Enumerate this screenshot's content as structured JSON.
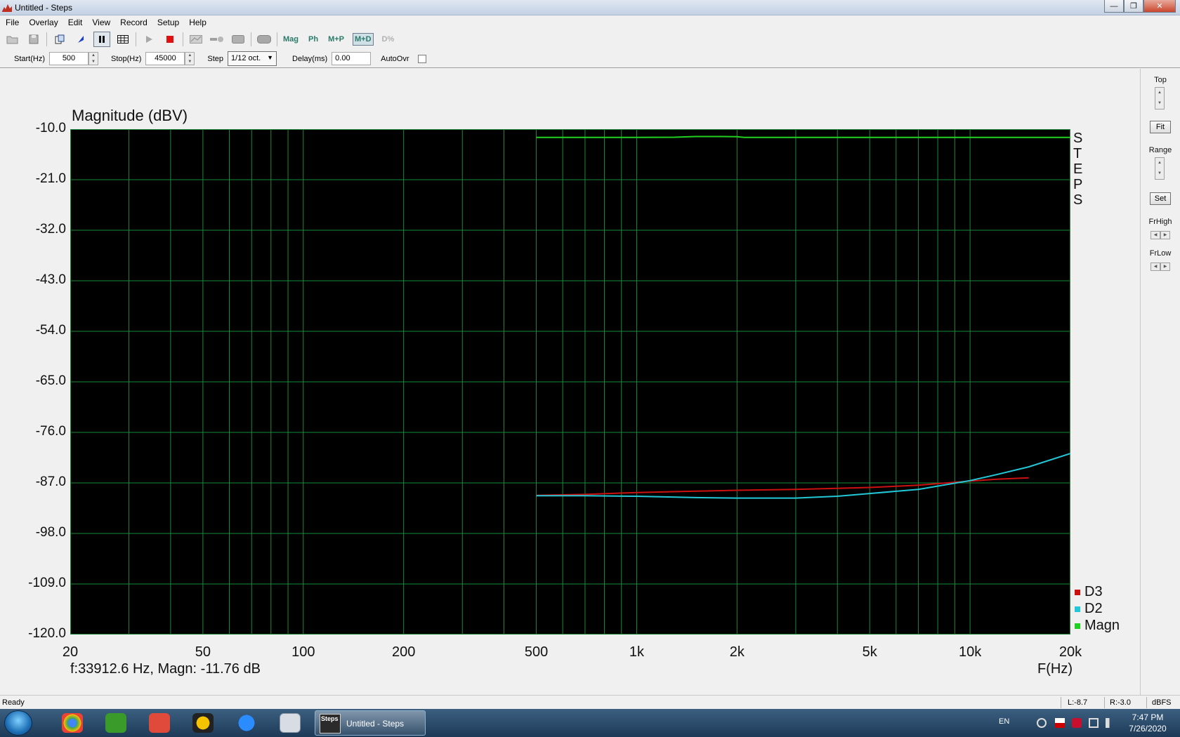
{
  "window": {
    "title": "Untitled - Steps",
    "min_glyph": "—",
    "max_glyph": "❐",
    "close_glyph": "✕"
  },
  "menu": [
    "File",
    "Overlay",
    "Edit",
    "View",
    "Record",
    "Setup",
    "Help"
  ],
  "toolbar": {
    "text_buttons": [
      {
        "label": "Mag",
        "state": "normal"
      },
      {
        "label": "Ph",
        "state": "normal"
      },
      {
        "label": "M+P",
        "state": "normal"
      },
      {
        "label": "M+D",
        "state": "pressed"
      },
      {
        "label": "D%",
        "state": "disabled"
      }
    ]
  },
  "params": {
    "start_label": "Start(Hz)",
    "start_value": "500",
    "stop_label": "Stop(Hz)",
    "stop_value": "45000",
    "step_label": "Step",
    "step_value": "1/12 oct.",
    "delay_label": "Delay(ms)",
    "delay_value": "0.00",
    "autoovr_label": "AutoOvr",
    "autoovr_checked": false
  },
  "chart_data": {
    "type": "line",
    "title": "Magnitude (dBV)",
    "xlabel": "F(Hz)",
    "x_scale": "log",
    "xlim": [
      20,
      20000
    ],
    "ylim": [
      -120,
      -10
    ],
    "grid": true,
    "background": "#000000",
    "grid_color": "#1a8a3a",
    "yticks": [
      "-10.0",
      "-21.0",
      "-32.0",
      "-43.0",
      "-54.0",
      "-65.0",
      "-76.0",
      "-87.0",
      "-98.0",
      "-109.0",
      "-120.0"
    ],
    "xticks": [
      {
        "v": 20,
        "label": "20"
      },
      {
        "v": 50,
        "label": "50"
      },
      {
        "v": 100,
        "label": "100"
      },
      {
        "v": 200,
        "label": "200"
      },
      {
        "v": 500,
        "label": "500"
      },
      {
        "v": 1000,
        "label": "1k"
      },
      {
        "v": 2000,
        "label": "2k"
      },
      {
        "v": 5000,
        "label": "5k"
      },
      {
        "v": 10000,
        "label": "10k"
      },
      {
        "v": 20000,
        "label": "20k"
      }
    ],
    "side_label": [
      "S",
      "T",
      "E",
      "P",
      "S"
    ],
    "legend_position": "bottom-right",
    "series": [
      {
        "name": "D3",
        "color": "#cc1111",
        "x": [
          500,
          700,
          1000,
          1500,
          2000,
          3000,
          5000,
          7000,
          10000,
          12000,
          15000
        ],
        "y": [
          -89.7,
          -89.5,
          -89.1,
          -88.8,
          -88.6,
          -88.4,
          -88.0,
          -87.5,
          -86.6,
          -86.2,
          -85.9
        ]
      },
      {
        "name": "D2",
        "color": "#22c8d8",
        "x": [
          500,
          700,
          1000,
          1500,
          2000,
          3000,
          4000,
          5000,
          7000,
          10000,
          12000,
          15000,
          20000
        ],
        "y": [
          -89.8,
          -89.8,
          -89.9,
          -90.2,
          -90.3,
          -90.3,
          -89.9,
          -89.3,
          -88.4,
          -86.5,
          -85.2,
          -83.5,
          -80.6
        ]
      },
      {
        "name": "Magn",
        "color": "#22d022",
        "x": [
          500,
          1000,
          1300,
          1500,
          1800,
          2000,
          2100,
          5000,
          10000,
          20000
        ],
        "y": [
          -11.8,
          -11.8,
          -11.75,
          -11.6,
          -11.6,
          -11.65,
          -11.8,
          -11.8,
          -11.8,
          -11.8
        ]
      }
    ]
  },
  "readout": "f:33912.6 Hz, Magn: -11.76 dB",
  "sidepanel": {
    "top_label": "Top",
    "fit_label": "Fit",
    "range_label": "Range",
    "set_label": "Set",
    "frhigh_label": "FrHigh",
    "frlow_label": "FrLow"
  },
  "status": {
    "ready": "Ready",
    "left": "L:-8.7",
    "right": "R:-3.0",
    "unit": "dBFS"
  },
  "taskbar": {
    "window_label": "Untitled - Steps",
    "thumb_label": "Steps",
    "lang": "EN",
    "time": "7:47 PM",
    "date": "7/26/2020"
  }
}
